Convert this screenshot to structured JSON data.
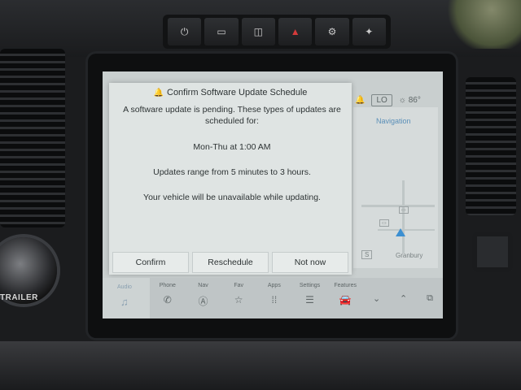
{
  "dialog": {
    "title": "Confirm Software Update Schedule",
    "message": "A software update is pending. These types of updates are scheduled for:",
    "schedule": "Mon-Thu at 1:00 AM",
    "duration": "Updates range from 5 minutes to 3 hours.",
    "warning": "Your vehicle will be unavailable while updating.",
    "buttons": {
      "confirm": "Confirm",
      "reschedule": "Reschedule",
      "not_now": "Not now"
    }
  },
  "status": {
    "fan_level": "LO",
    "temperature": "86°"
  },
  "navigation": {
    "title": "Navigation",
    "city": "Granbury",
    "compass": "S"
  },
  "dock": {
    "audio": "Audio",
    "items": [
      "Phone",
      "Nav",
      "Fav",
      "Apps",
      "Settings",
      "Features"
    ]
  },
  "vehicle": {
    "knob_label": "TRAILER"
  },
  "colors": {
    "screen_bg": "#c9cfcf",
    "dialog_bg": "#dfe4e3",
    "nav_accent": "#5a8fb8",
    "hazard": "#d43b3b"
  }
}
